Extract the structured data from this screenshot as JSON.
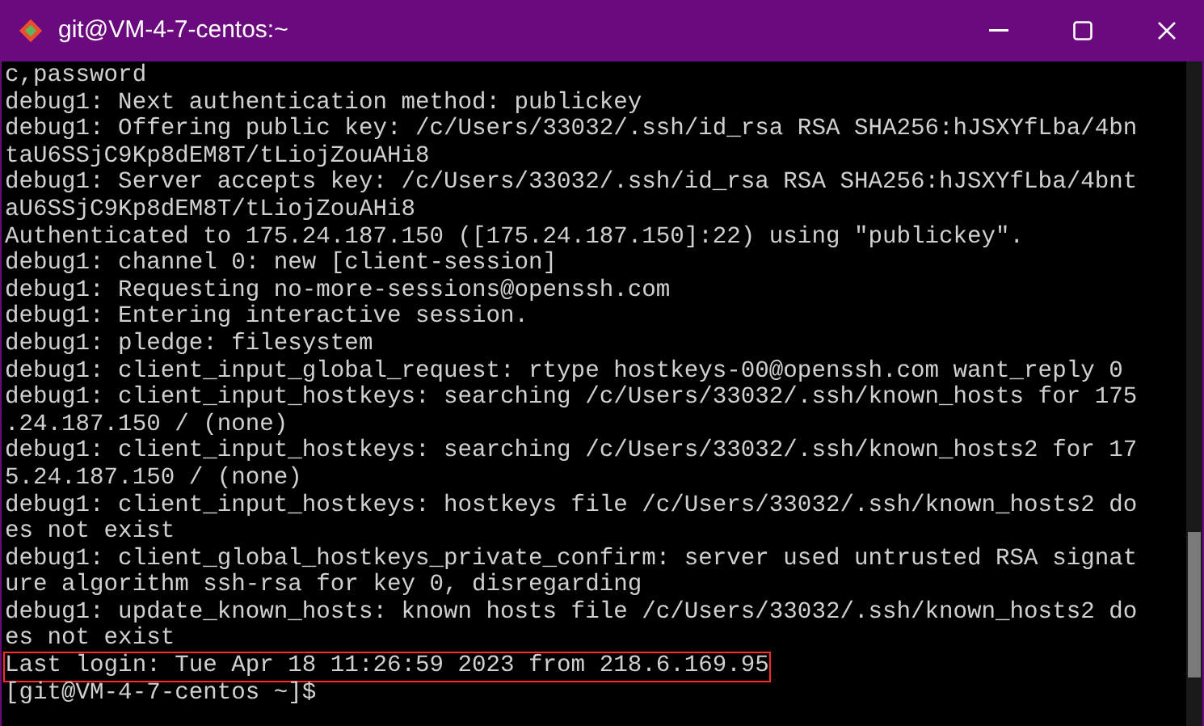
{
  "window": {
    "title": "git@VM-4-7-centos:~"
  },
  "terminal": {
    "lines": [
      {
        "text": "c,password",
        "boxed": false
      },
      {
        "text": "debug1: Next authentication method: publickey",
        "boxed": false
      },
      {
        "text": "debug1: Offering public key: /c/Users/33032/.ssh/id_rsa RSA SHA256:hJSXYfLba/4bn",
        "boxed": false
      },
      {
        "text": "taU6SSjC9Kp8dEM8T/tLiojZouAHi8",
        "boxed": false
      },
      {
        "text": "debug1: Server accepts key: /c/Users/33032/.ssh/id_rsa RSA SHA256:hJSXYfLba/4bnt",
        "boxed": false
      },
      {
        "text": "aU6SSjC9Kp8dEM8T/tLiojZouAHi8",
        "boxed": false
      },
      {
        "text": "Authenticated to 175.24.187.150 ([175.24.187.150]:22) using \"publickey\".",
        "boxed": false
      },
      {
        "text": "debug1: channel 0: new [client-session]",
        "boxed": false
      },
      {
        "text": "debug1: Requesting no-more-sessions@openssh.com",
        "boxed": false
      },
      {
        "text": "debug1: Entering interactive session.",
        "boxed": false
      },
      {
        "text": "debug1: pledge: filesystem",
        "boxed": false
      },
      {
        "text": "debug1: client_input_global_request: rtype hostkeys-00@openssh.com want_reply 0",
        "boxed": false
      },
      {
        "text": "debug1: client_input_hostkeys: searching /c/Users/33032/.ssh/known_hosts for 175",
        "boxed": false
      },
      {
        "text": ".24.187.150 / (none)",
        "boxed": false
      },
      {
        "text": "debug1: client_input_hostkeys: searching /c/Users/33032/.ssh/known_hosts2 for 17",
        "boxed": false
      },
      {
        "text": "5.24.187.150 / (none)",
        "boxed": false
      },
      {
        "text": "debug1: client_input_hostkeys: hostkeys file /c/Users/33032/.ssh/known_hosts2 do",
        "boxed": false
      },
      {
        "text": "es not exist",
        "boxed": false
      },
      {
        "text": "debug1: client_global_hostkeys_private_confirm: server used untrusted RSA signat",
        "boxed": false
      },
      {
        "text": "ure algorithm ssh-rsa for key 0, disregarding",
        "boxed": false
      },
      {
        "text": "debug1: update_known_hosts: known hosts file /c/Users/33032/.ssh/known_hosts2 do",
        "boxed": false
      },
      {
        "text": "es not exist",
        "boxed": false
      },
      {
        "text": "Last login: Tue Apr 18 11:26:59 2023 from 218.6.169.95",
        "boxed": true
      },
      {
        "text": "[git@VM-4-7-centos ~]$",
        "boxed": false
      }
    ]
  }
}
